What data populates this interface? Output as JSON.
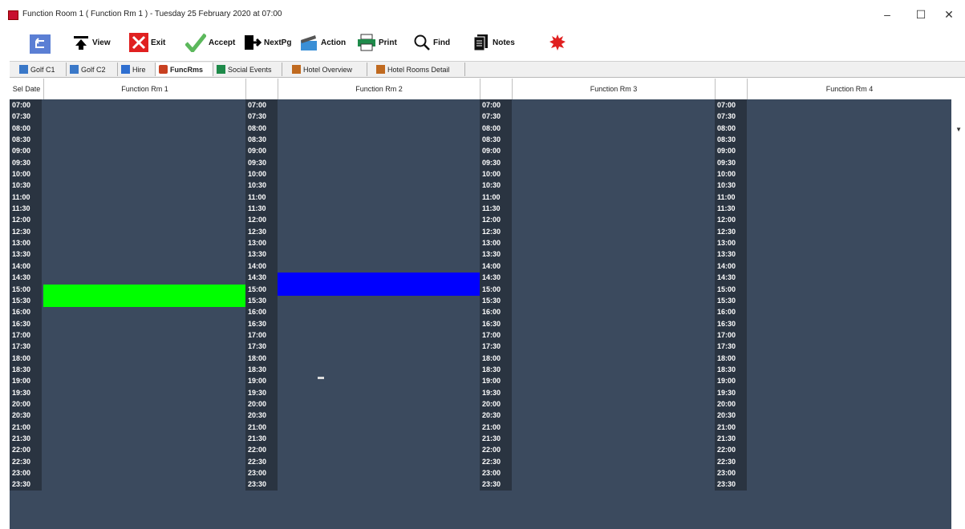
{
  "window": {
    "title": "Function Room 1 ( Function Rm 1 )  - Tuesday 25 February 2020 at 07:00",
    "minimize": "–",
    "maximize": "☐",
    "close": "✕"
  },
  "toolbar": {
    "view": "View",
    "exit": "Exit",
    "accept": "Accept",
    "nextpg": "NextPg",
    "action": "Action",
    "print": "Print",
    "find": "Find",
    "notes": "Notes"
  },
  "tabs": [
    {
      "label": "Golf C1"
    },
    {
      "label": "Golf C2"
    },
    {
      "label": "Hire"
    },
    {
      "label": "FuncRms"
    },
    {
      "label": "Social Events"
    },
    {
      "label": "Hotel Overview"
    },
    {
      "label": "Hotel Rooms Detail"
    }
  ],
  "header": {
    "sel_date": "Sel Date",
    "rooms": [
      "Function Rm 1",
      "Function Rm 2",
      "Function Rm 3",
      "Function Rm 4"
    ]
  },
  "times": [
    "07:00",
    "07:30",
    "08:00",
    "08:30",
    "09:00",
    "09:30",
    "10:00",
    "10:30",
    "11:00",
    "11:30",
    "12:00",
    "12:30",
    "13:00",
    "13:30",
    "14:00",
    "14:30",
    "15:00",
    "15:30",
    "16:00",
    "16:30",
    "17:00",
    "17:30",
    "18:00",
    "18:30",
    "19:00",
    "19:30",
    "20:00",
    "20:30",
    "21:00",
    "21:30",
    "22:00",
    "22:30",
    "23:00",
    "23:30"
  ],
  "bookings": [
    {
      "room": "Function Rm 1",
      "start": "15:00",
      "end": "16:00",
      "color": "#00ff00"
    },
    {
      "room": "Function Rm 2",
      "start": "14:30",
      "end": "15:30",
      "color": "#0000ff"
    }
  ],
  "colors": {
    "grid_bg": "#3b4a5e",
    "time_bg": "#2a3441"
  }
}
